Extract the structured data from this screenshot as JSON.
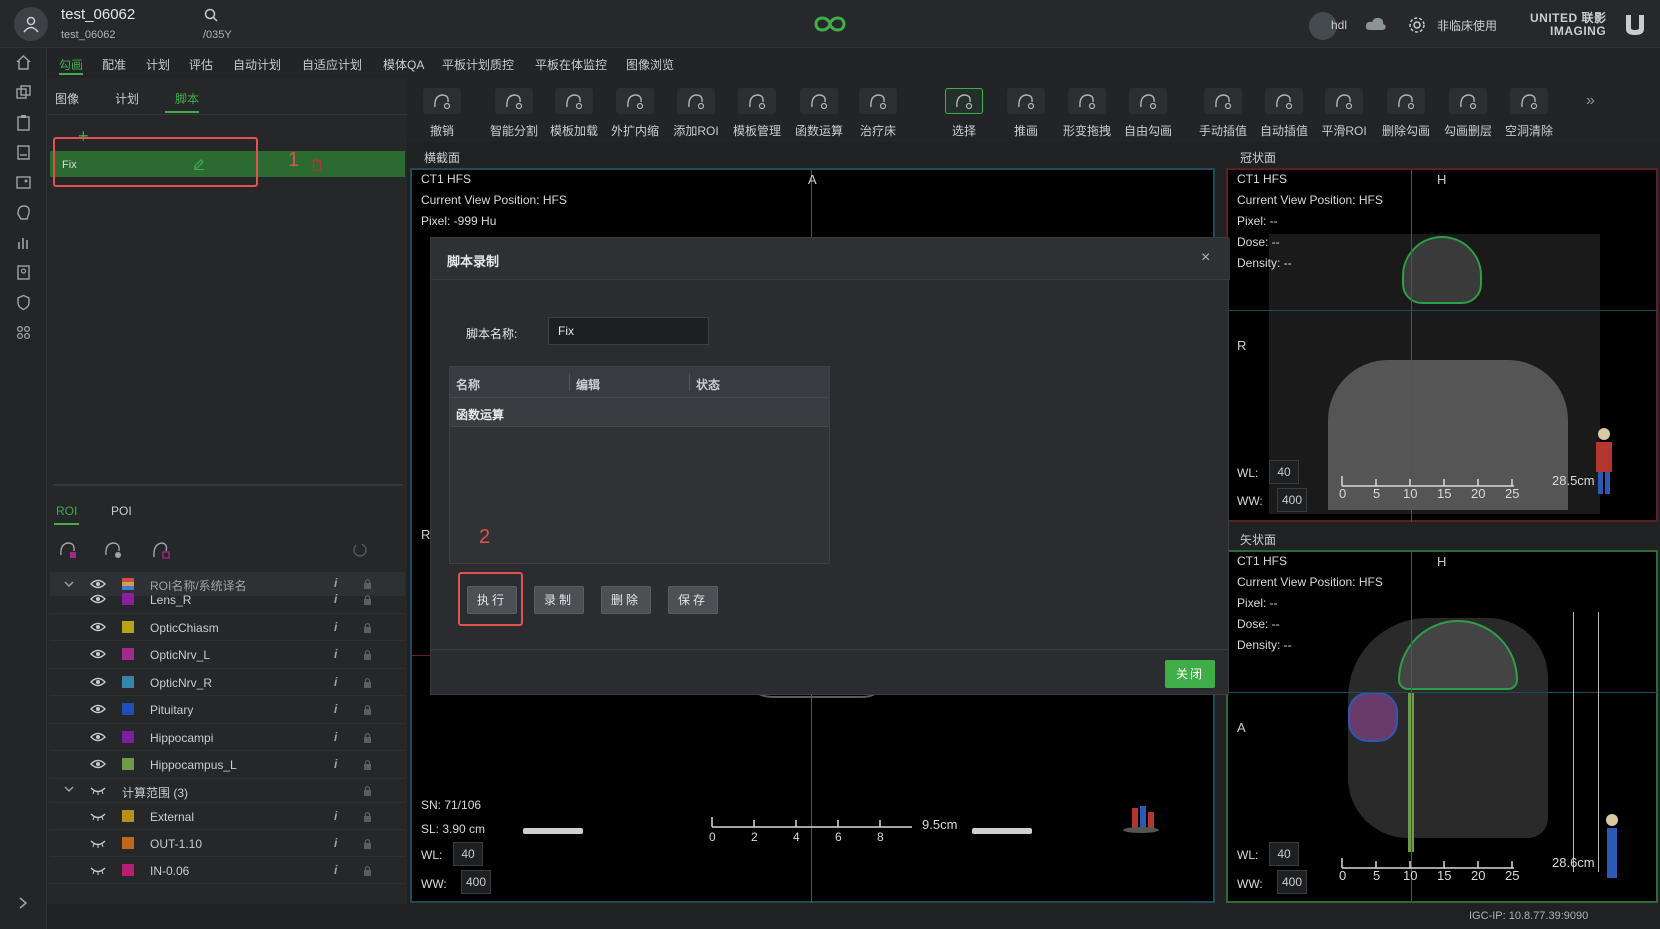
{
  "header": {
    "patient_name": "test_06062",
    "patient_sub": "test_06062",
    "patient_id": "/035Y",
    "user": "hdl",
    "mode": "非临床使用",
    "brand_line1": "UNITED 联影",
    "brand_line2": "IMAGING"
  },
  "menu": [
    "勾画",
    "配准",
    "计划",
    "评估",
    "自动计划",
    "自适应计划",
    "模体QA",
    "平板计划质控",
    "平板在体监控",
    "图像浏览"
  ],
  "subtabs": [
    "图像",
    "计划",
    "脚本"
  ],
  "script_item": "Fix",
  "annotation_1": "1",
  "annotation_2": "2",
  "roi_tabs": [
    "ROI",
    "POI"
  ],
  "roi_header": "ROI名称/系统译名",
  "rois": [
    {
      "name": "Lens_R",
      "color": "#8a1f9e"
    },
    {
      "name": "OpticChiasm",
      "color": "#b8a315"
    },
    {
      "name": "OpticNrv_L",
      "color": "#a12a8a"
    },
    {
      "name": "OpticNrv_R",
      "color": "#3a86a8"
    },
    {
      "name": "Pituitary",
      "color": "#1d4fb8"
    },
    {
      "name": "Hippocampi",
      "color": "#7a1f9e"
    },
    {
      "name": "Hippocampus_L",
      "color": "#6f9a4a"
    }
  ],
  "calc_group": "计算范围 (3)",
  "calc_rois": [
    {
      "name": "External",
      "color": "#b8901d"
    },
    {
      "name": "OUT-1.10",
      "color": "#c0691d"
    },
    {
      "name": "IN-0.06",
      "color": "#b81d74"
    }
  ],
  "toolbar": [
    "撤销",
    "智能分割",
    "模板加载",
    "外扩内缩",
    "添加ROI",
    "模板管理",
    "函数运算",
    "治疗床",
    "选择",
    "推画",
    "形变拖拽",
    "自由勾画",
    "手动插值",
    "自动插值",
    "平滑ROI",
    "删除勾画",
    "勾画删层",
    "空洞清除"
  ],
  "views": {
    "axial": {
      "title": "横截面",
      "line1": "CT1 HFS",
      "line2": "Current View Position: HFS",
      "line3": "Pixel:  -999 Hu",
      "dir_top": "A",
      "dir_left": "R",
      "sn": "SN: 71/106",
      "sl": "SL: 3.90 cm",
      "wl_label": "WL:",
      "wl": "40",
      "ww_label": "WW:",
      "ww": "400",
      "scale": "9.5cm",
      "ticks": [
        "0",
        "2",
        "4",
        "6",
        "8"
      ]
    },
    "coronal": {
      "title": "冠状面",
      "line1": "CT1 HFS",
      "line2": "Current View Position: HFS",
      "line3": "Pixel:  --",
      "line4": "Dose:  --",
      "line5": "Density:  --",
      "dir_top": "H",
      "dir_left": "R",
      "wl_label": "WL:",
      "wl": "40",
      "ww_label": "WW:",
      "ww": "400",
      "scale": "28.5cm",
      "ticks": [
        "0",
        "5",
        "10",
        "15",
        "20",
        "25"
      ]
    },
    "sagittal": {
      "title": "矢状面",
      "line1": "CT1 HFS",
      "line2": "Current View Position: HFS",
      "line3": "Pixel:  --",
      "line4": "Dose:  --",
      "line5": "Density:  --",
      "dir_top": "H",
      "dir_left": "A",
      "wl_label": "WL:",
      "wl": "40",
      "ww_label": "WW:",
      "ww": "400",
      "scale": "28.6cm",
      "ticks": [
        "0",
        "5",
        "10",
        "15",
        "20",
        "25"
      ]
    }
  },
  "dialog": {
    "title": "脚本录制",
    "close": "×",
    "name_label": "脚本名称:",
    "name_value": "Fix",
    "col_name": "名称",
    "col_edit": "编辑",
    "col_status": "状态",
    "row1": "函数运算",
    "btn_execute": "执行",
    "btn_record": "录制",
    "btn_delete": "删除",
    "btn_save": "保存",
    "btn_close": "关闭"
  },
  "status": "IGC-IP: 10.8.77.39:9090"
}
